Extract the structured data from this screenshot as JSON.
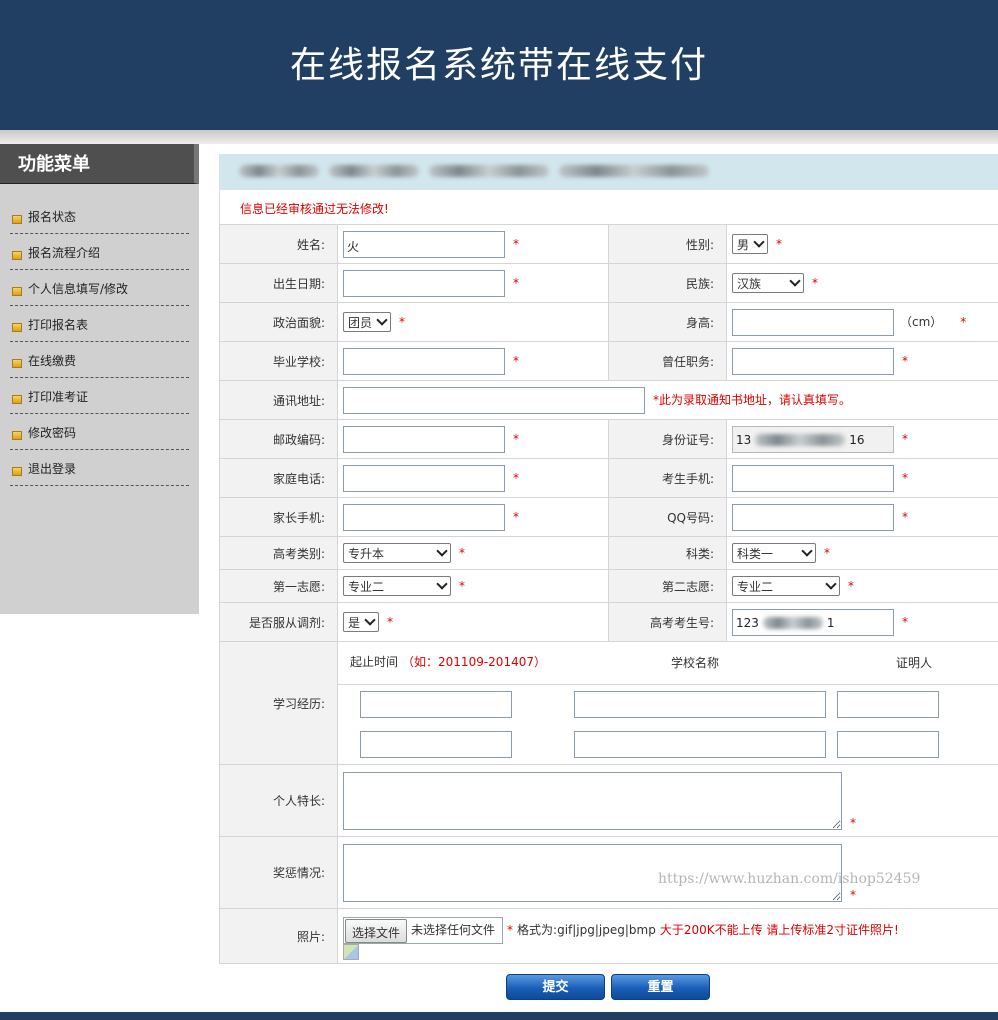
{
  "header": {
    "title": "在线报名系统带在线支付"
  },
  "sidebar": {
    "title": "功能菜单",
    "items": [
      {
        "label": "报名状态",
        "icon": "folder-icon"
      },
      {
        "label": "报名流程介绍",
        "icon": "folder-icon"
      },
      {
        "label": "个人信息填写/修改",
        "icon": "folder-icon"
      },
      {
        "label": "打印报名表",
        "icon": "folder-icon"
      },
      {
        "label": "在线缴费",
        "icon": "folder-icon"
      },
      {
        "label": "打印准考证",
        "icon": "folder-icon"
      },
      {
        "label": "修改密码",
        "icon": "folder-icon"
      },
      {
        "label": "退出登录",
        "icon": "folder-icon"
      }
    ]
  },
  "form": {
    "notice": "信息已经审核通过无法修改!",
    "required_mark": "*",
    "name": {
      "label": "姓名:",
      "value": "火"
    },
    "gender": {
      "label": "性别:",
      "value": "男"
    },
    "birth": {
      "label": "出生日期:",
      "value": ""
    },
    "ethnicity": {
      "label": "民族:",
      "value": "汉族"
    },
    "political": {
      "label": "政治面貌:",
      "value": "团员"
    },
    "height": {
      "label": "身高:",
      "value": "",
      "unit": "（cm）"
    },
    "school": {
      "label": "毕业学校:",
      "value": ""
    },
    "former_post": {
      "label": "曾任职务:",
      "value": ""
    },
    "address": {
      "label": "通讯地址:",
      "value": "",
      "hint": "*此为录取通知书地址，请认真填写。"
    },
    "postcode": {
      "label": "邮政编码:",
      "value": ""
    },
    "id_number": {
      "label": "身份证号:",
      "value_start": "13",
      "value_end": "16"
    },
    "home_phone": {
      "label": "家庭电话:",
      "value": ""
    },
    "mobile": {
      "label": "考生手机:",
      "value": ""
    },
    "parent_mobile": {
      "label": "家长手机:",
      "value": ""
    },
    "qq": {
      "label": "QQ号码:",
      "value": ""
    },
    "exam_category": {
      "label": "高考类别:",
      "value": "专升本"
    },
    "subject": {
      "label": "科类:",
      "value": "科类一"
    },
    "choice1": {
      "label": "第一志愿:",
      "value": "专业二"
    },
    "choice2": {
      "label": "第二志愿:",
      "value": "专业二"
    },
    "obey": {
      "label": "是否服从调剂:",
      "value": "是"
    },
    "exam_no": {
      "label": "高考考生号:",
      "value_start": "123",
      "value_end": "1"
    },
    "study": {
      "label": "学习经历:",
      "col_time": "起止时间",
      "example_prefix": "（如：",
      "example_value": "201109-201407",
      "example_suffix": "）",
      "col_school": "学校名称",
      "col_witness": "证明人"
    },
    "specialty": {
      "label": "个人特长:",
      "value": ""
    },
    "rewards": {
      "label": "奖惩情况:",
      "value": ""
    },
    "photo": {
      "label": "照片:",
      "choose_button": "选择文件",
      "no_file": "未选择任何文件",
      "formats": "格式为:gif|jpg|jpeg|bmp",
      "limit": "大于200K不能上传 请上传标准2寸证件照片!"
    }
  },
  "buttons": {
    "submit": "提交",
    "reset": "重置"
  },
  "watermark": "https://www.huzhan.com/ishop52459",
  "colors": {
    "header_bg": "#213f63",
    "required": "#e00000",
    "form_head_bg": "#d2e6ee",
    "sidebar_bg": "#d0d0d0"
  }
}
